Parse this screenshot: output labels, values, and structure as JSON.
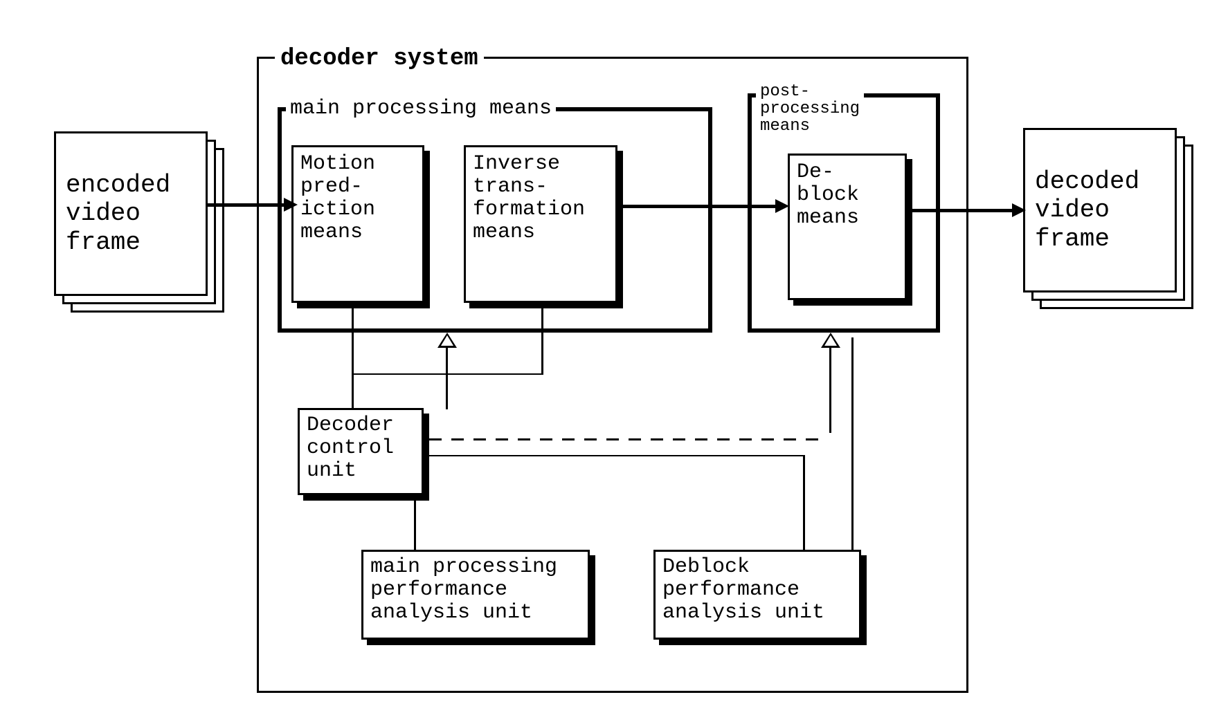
{
  "input_stack": {
    "line1": "encoded",
    "line2": "video",
    "line3": "frame"
  },
  "output_stack": {
    "line1": "decoded",
    "line2": "video",
    "line3": "frame"
  },
  "decoder_system_label": "decoder system",
  "main_processing_label": "main processing means",
  "post_processing": {
    "line1": "post-",
    "line2": "processing",
    "line3": "means"
  },
  "motion_prediction": {
    "line1": "Motion",
    "line2": "pred-",
    "line3": "iction",
    "line4": "means"
  },
  "inverse_transform": {
    "line1": "Inverse",
    "line2": "trans-",
    "line3": "formation",
    "line4": "means"
  },
  "deblock": {
    "line1": "De-",
    "line2": "block",
    "line3": "means"
  },
  "decoder_control": {
    "line1": "Decoder",
    "line2": "control",
    "line3": "unit"
  },
  "main_perf": {
    "line1": "main processing",
    "line2": "performance",
    "line3": "analysis unit"
  },
  "deblock_perf": {
    "line1": "Deblock",
    "line2": "performance",
    "line3": "analysis unit"
  }
}
